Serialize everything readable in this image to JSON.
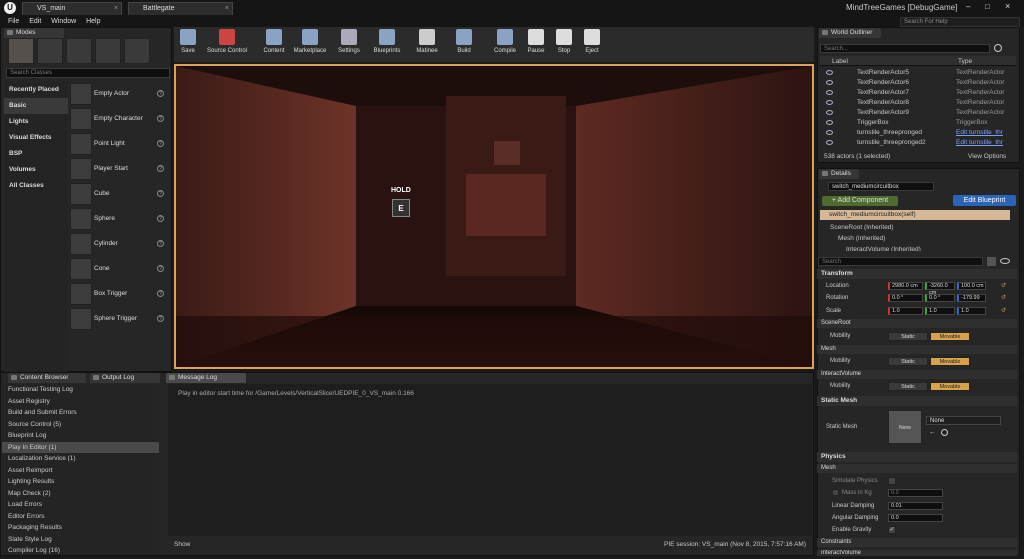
{
  "title": {
    "tabs": [
      {
        "label": "VS_main"
      },
      {
        "label": "Battlegate"
      }
    ],
    "project": "MindTreeGames [DebugGame]",
    "search_help": "Search For Help"
  },
  "menu": [
    "File",
    "Edit",
    "Window",
    "Help"
  ],
  "modes": {
    "tab": "Modes",
    "search_placeholder": "Search Classes",
    "categories": [
      "Recently Placed",
      "Basic",
      "Lights",
      "Visual Effects",
      "BSP",
      "Volumes",
      "All Classes"
    ],
    "items": [
      "Empty Actor",
      "Empty Character",
      "Point Light",
      "Player Start",
      "Cube",
      "Sphere",
      "Cylinder",
      "Cone",
      "Box Trigger",
      "Sphere Trigger"
    ]
  },
  "toolbar": [
    "Save",
    "Source Control",
    "Content",
    "Marketplace",
    "Settings",
    "Blueprints",
    "Matinee",
    "Build",
    "Compile",
    "Pause",
    "Stop",
    "Eject"
  ],
  "viewport": {
    "hold_label": "HOLD",
    "key_label": "E"
  },
  "outliner": {
    "tab": "World Outliner",
    "search_placeholder": "Search...",
    "col_label": "Label",
    "col_type": "Type",
    "rows": [
      {
        "label": "TextRenderActor5",
        "type": "TextRenderActor"
      },
      {
        "label": "TextRenderActor6",
        "type": "TextRenderActor"
      },
      {
        "label": "TextRenderActor7",
        "type": "TextRenderActor"
      },
      {
        "label": "TextRenderActor8",
        "type": "TextRenderActor"
      },
      {
        "label": "TextRenderActor9",
        "type": "TextRenderActor"
      },
      {
        "label": "TriggerBox",
        "type": "TriggerBox"
      },
      {
        "label": "turnstile_threepronged",
        "type": "Edit turnstile_thr"
      },
      {
        "label": "turnstile_threepronged2",
        "type": "Edit turnstile_thr"
      }
    ],
    "status": "538 actors (1 selected)",
    "view_options": "View Options"
  },
  "details": {
    "tab": "Details",
    "name_value": "switch_mediumcircuitbox",
    "add_component": "+ Add Component",
    "edit_blueprint": "Edit Blueprint",
    "self_label": "switch_mediumcircuitbox(self)",
    "tree": [
      "SceneRoot (Inherited)",
      "Mesh (Inherited)",
      "InteractVolume (Inherited)"
    ],
    "search_placeholder": "Search",
    "transform": "Transform",
    "location_label": "Location",
    "location": [
      "2980.0 cm",
      "-3260.0 cm",
      "100.0 cm"
    ],
    "rotation_label": "Rotation",
    "rotation": [
      "0.0 °",
      "0.0 °",
      "-179.99"
    ],
    "scale_label": "Scale",
    "scale": [
      "1.0",
      "1.0",
      "1.0"
    ],
    "mobility_sections": [
      "SceneRoot",
      "Mesh",
      "InteractVolume"
    ],
    "mobility_label": "Mobility",
    "static_label": "Static",
    "movable_label": "Movable",
    "static_mesh": "Static Mesh",
    "static_mesh_label": "Static Mesh",
    "mesh_thumb": "None",
    "mesh_value": "None",
    "physics": "Physics",
    "mesh_sub": "Mesh",
    "simulate_physics": "Simulate Physics",
    "mass_in_kg": "Mass in Kg",
    "mass_value": "0.0",
    "linear_damping": "Linear Damping",
    "linear_value": "0.01",
    "angular_damping": "Angular Damping",
    "angular_value": "0.0",
    "enable_gravity": "Enable Gravity",
    "constraints": "Constraints",
    "interact_volume_cut": "InteractVolume"
  },
  "content_tabs": [
    "Content Browser",
    "Output Log",
    "Message Log"
  ],
  "log_categories": [
    "Functional Testing Log",
    "Asset Registry",
    "Build and Submit Errors",
    "Source Control (5)",
    "Blueprint Log",
    "Play In Editor (1)",
    "Localization Service (1)",
    "Asset Reimport",
    "Lighting Results",
    "Map Check (2)",
    "Load Errors",
    "Editor Errors",
    "Packaging Results",
    "Slate Style Log",
    "Compiler Log (16)"
  ],
  "log_message": "Play in editor start time for /Game/Levels/VerticalSlice/UEDPIE_0_VS_main 0.166",
  "show_label": "Show",
  "pie_session": "PIE session: VS_main (Nov 8, 2015, 7:57:16 AM)"
}
